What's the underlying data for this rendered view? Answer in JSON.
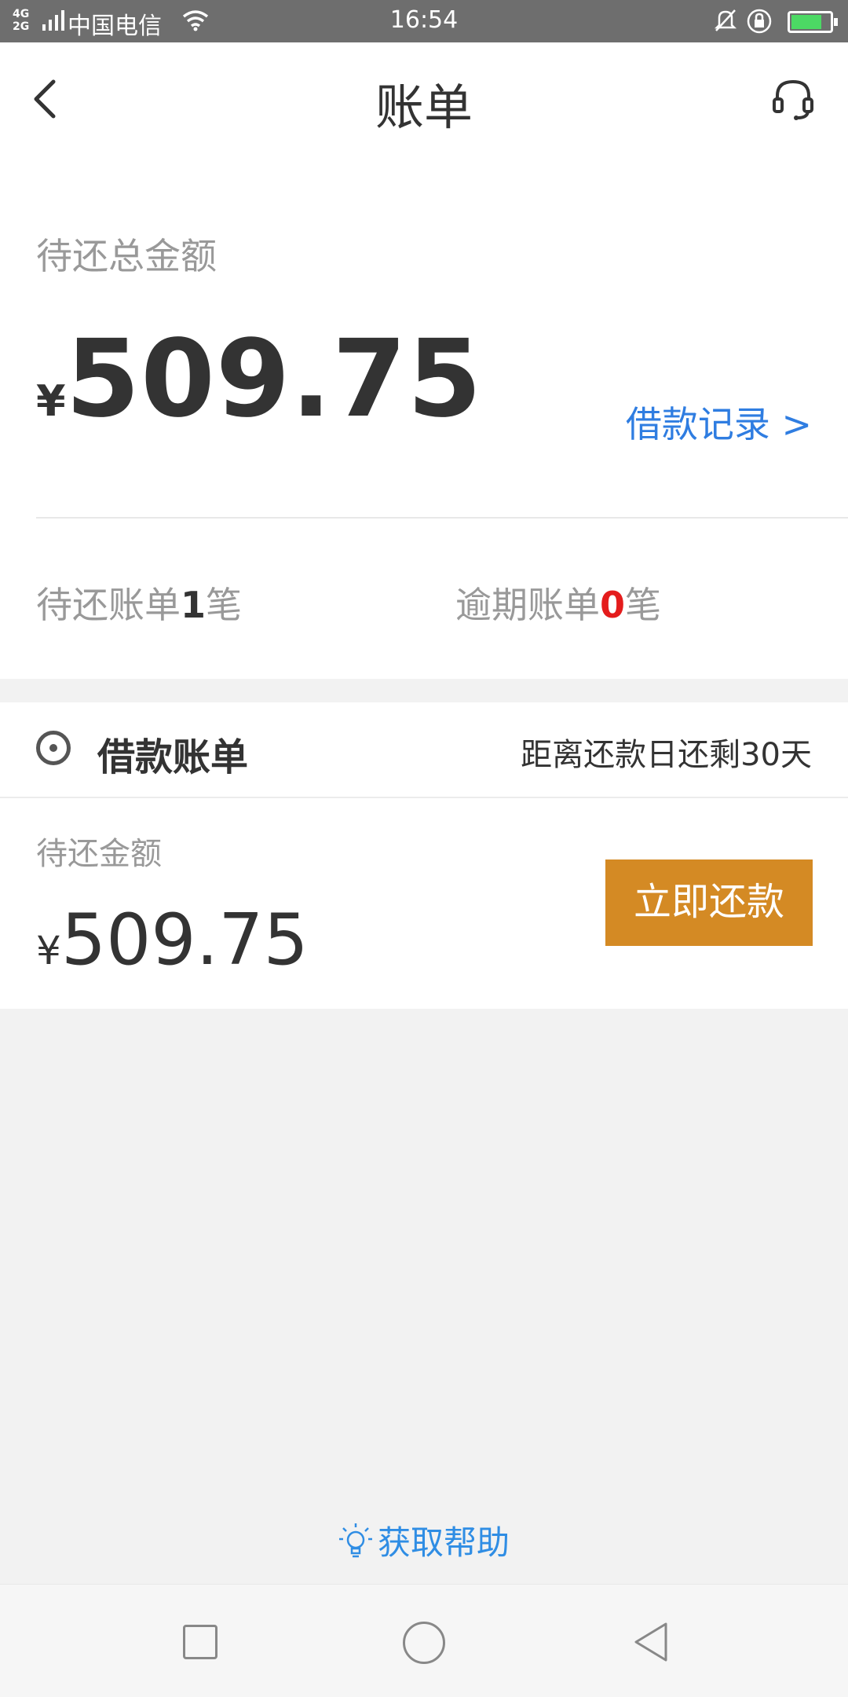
{
  "status_bar": {
    "network": "4G\n2G",
    "carrier": "中国电信",
    "time": "16:54",
    "battery_color": "#4cd964"
  },
  "header": {
    "title": "账单",
    "back_icon": "chevron-left-icon",
    "service_icon": "headset-icon"
  },
  "summary": {
    "total_label": "待还总金额",
    "currency": "¥",
    "total_amount": "509.75",
    "record_link": "借款记录 >",
    "pending_prefix": "待还账单",
    "pending_count": "1",
    "pending_suffix": "笔",
    "overdue_prefix": "逾期账单",
    "overdue_count": "0",
    "overdue_suffix": "笔"
  },
  "loan_bill": {
    "title": "借款账单",
    "days_left": "距离还款日还剩30天",
    "amount_label": "待还金额",
    "currency": "¥",
    "amount": "509.75",
    "pay_button": "立即还款"
  },
  "help": {
    "label": "获取帮助",
    "icon": "lightbulb-icon"
  },
  "colors": {
    "accent_blue": "#2f7de1",
    "pay_orange": "#d48a24",
    "overdue_red": "#e41c1c"
  }
}
